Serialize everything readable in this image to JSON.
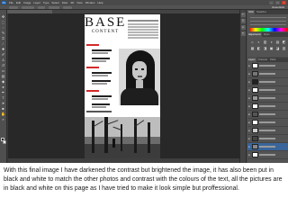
{
  "app": {
    "logo": "Ps",
    "menus": [
      "File",
      "Edit",
      "Image",
      "Layer",
      "Type",
      "Select",
      "Filter",
      "3D",
      "View",
      "Window",
      "Help"
    ],
    "workspace": "Essentials",
    "window_buttons": [
      "–",
      "□",
      "×"
    ]
  },
  "toolbar": {
    "tools": [
      "move-icon",
      "marquee-icon",
      "lasso-icon",
      "quick-select-icon",
      "crop-icon",
      "eyedropper-icon",
      "healing-icon",
      "brush-icon",
      "stamp-icon",
      "history-brush-icon",
      "eraser-icon",
      "gradient-icon",
      "blur-icon",
      "dodge-icon",
      "pen-icon",
      "type-icon",
      "path-select-icon",
      "shape-icon",
      "hand-icon",
      "zoom-icon"
    ],
    "foreground_color": "#000000",
    "background_color": "#ffffff"
  },
  "document": {
    "masthead_title": "BASE",
    "masthead_subtitle": "CONTENT",
    "accent_color": "#d32a2a"
  },
  "panels": {
    "top_tabs": [
      "Color",
      "Swatches"
    ],
    "mid_tabs": [
      "Adjustments",
      "Styles"
    ],
    "layer_tabs": [
      "Layers",
      "Channels",
      "Paths"
    ],
    "adjustment_icons": [
      "☼",
      "◐",
      "▥",
      "◑",
      "▤",
      "◩",
      "▦",
      "◧",
      "◨",
      "▣",
      "◪",
      "▧"
    ],
    "layer_count": 12,
    "selected_layer_index": 10
  },
  "caption": {
    "text": "With this final image I have darkened the contrast but brightened the image, it has also been put in black and white to match the other photos and contrast with the colours of the text, all the pictures are in black and white on this page as I have tried to make it look simple but proffessional."
  }
}
